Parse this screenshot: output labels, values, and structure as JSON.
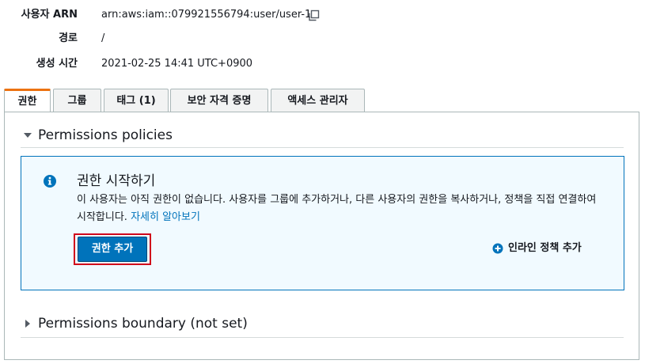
{
  "summary": {
    "arn_label": "사용자 ARN",
    "arn_value": "arn:aws:iam::079921556794:user/user-1",
    "path_label": "경로",
    "path_value": "/",
    "created_label": "생성 시간",
    "created_value": "2021-02-25 14:41 UTC+0900"
  },
  "tabs": [
    {
      "label": "권한",
      "active": true
    },
    {
      "label": "그룹",
      "active": false
    },
    {
      "label": "태그 (1)",
      "active": false
    },
    {
      "label": "보안 자격 증명",
      "active": false
    },
    {
      "label": "액세스 관리자",
      "active": false
    }
  ],
  "permissions_policies": {
    "title": "Permissions policies",
    "expanded": true
  },
  "info_box": {
    "title": "권한 시작하기",
    "description": "이 사용자는 아직 권한이 없습니다. 사용자를 그룹에 추가하거나, 다른 사용자의 권한을 복사하거나, 정책을 직접 연결하여 시작합니다.",
    "link_text": "자세히 알아보기",
    "primary_button": "권한 추가",
    "inline_button": "인라인 정책 추가"
  },
  "permissions_boundary": {
    "title": "Permissions boundary (not set)",
    "expanded": false
  },
  "colors": {
    "accent": "#0073bb",
    "active_tab": "#ec7211",
    "highlight": "#d0021b",
    "info_bg": "#f1faff"
  }
}
